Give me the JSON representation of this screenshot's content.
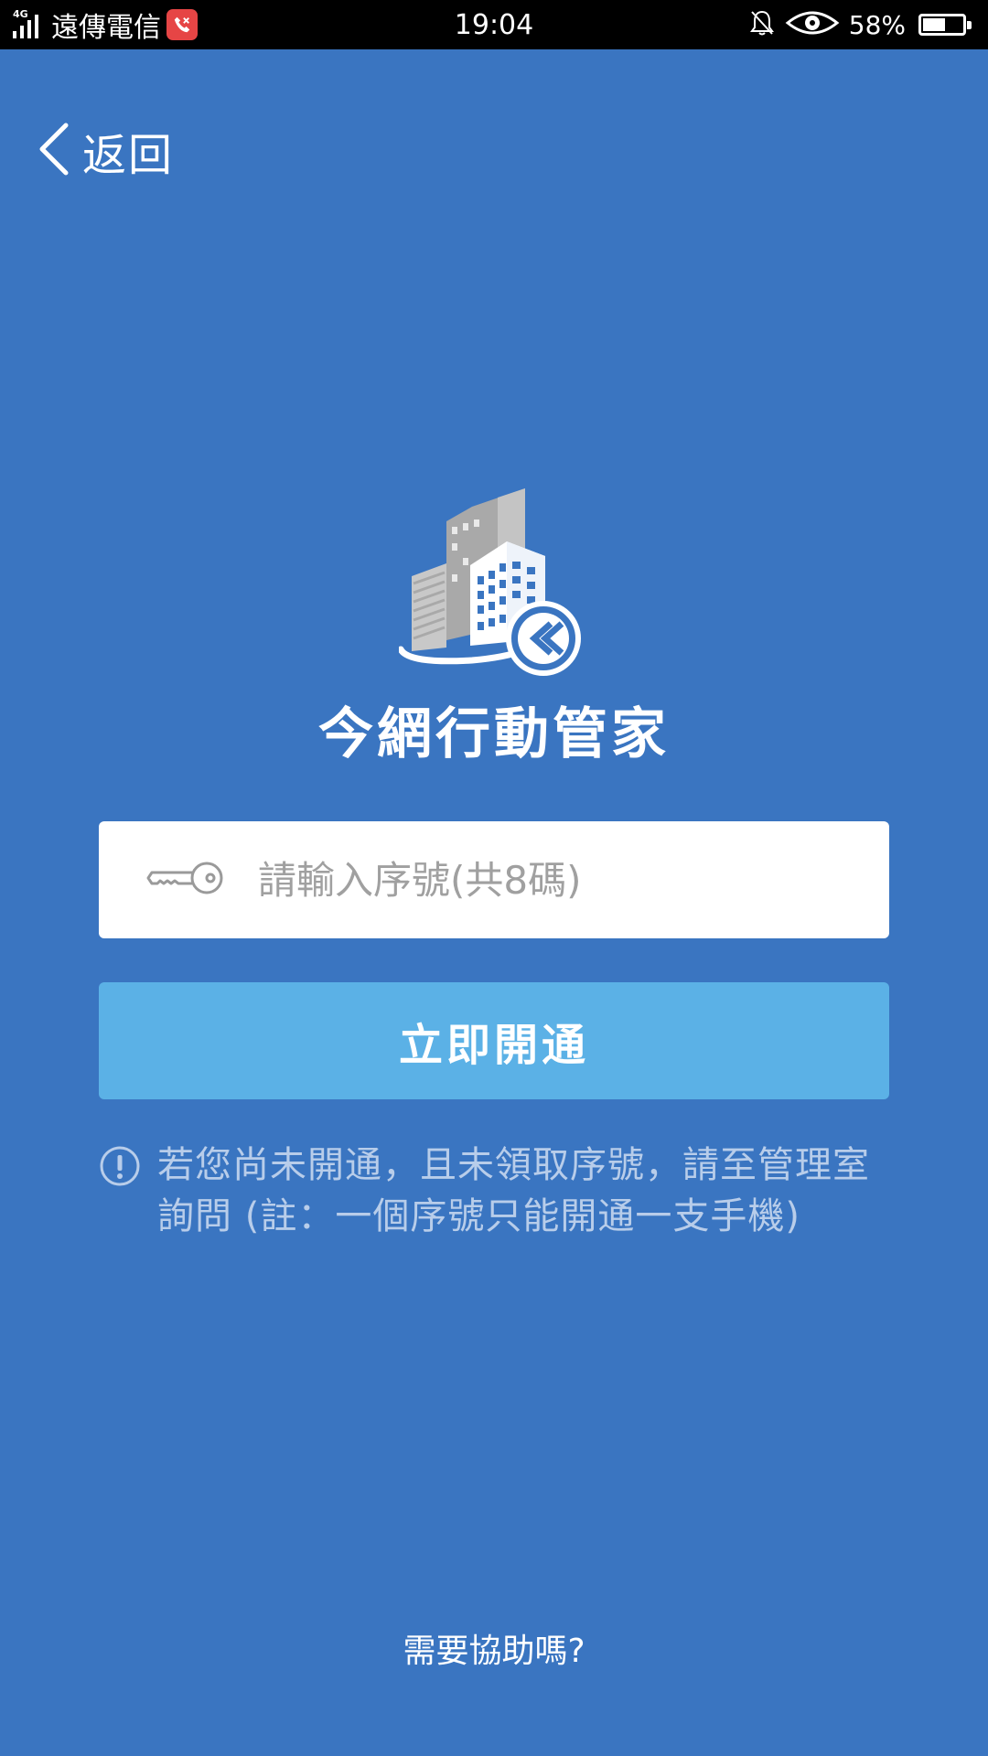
{
  "status_bar": {
    "network_type": "4G",
    "carrier": "遠傳電信",
    "time": "19:04",
    "battery_percent": "58%",
    "battery_level": 0.58,
    "icons": [
      "signal-icon",
      "call-badge-icon",
      "bell-off-icon",
      "eye-icon",
      "battery-icon"
    ]
  },
  "nav": {
    "back_label": "返回"
  },
  "app": {
    "title": "今網行動管家",
    "logo_icon": "building-logo-icon"
  },
  "form": {
    "serial_placeholder": "請輸入序號(共8碼)",
    "serial_value": "",
    "activate_label": "立即開通"
  },
  "notice": {
    "text": "若您尚未開通，且未領取序號，請至管理室詢問 (註：一個序號只能開通一支手機)"
  },
  "help": {
    "label": "需要協助嗎?"
  },
  "colors": {
    "background": "#3a75c1",
    "button": "#5bb1e6",
    "notice_text": "#b8cdea",
    "call_badge": "#e64545"
  }
}
